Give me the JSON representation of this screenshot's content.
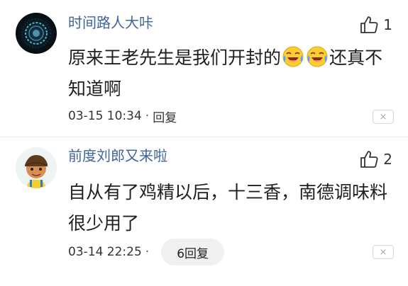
{
  "comments": [
    {
      "username": "时间路人大咔",
      "like_count": "1",
      "content_before": "原来王老先生是我们开封的",
      "emojis": [
        "laugh-cry-emoji",
        "laugh-cry-emoji"
      ],
      "content_after": "还真不知道啊",
      "date": "03-15 10:34",
      "separator": "·",
      "reply_label": "回复",
      "more_label": "×"
    },
    {
      "username": "前度刘郎又来啦",
      "like_count": "2",
      "content": "自从有了鸡精以后，十三香，南德调味料很少用了",
      "date": "03-14 22:25",
      "separator": "·",
      "reply_label": "6回复",
      "more_label": "×"
    }
  ],
  "icons": {
    "like": "thumbs-up-outline-icon",
    "more": "close-box-icon"
  },
  "colors": {
    "username": "#406599",
    "text": "#1f1f1f",
    "meta": "#333333",
    "pill_bg": "#f0f0f0"
  }
}
